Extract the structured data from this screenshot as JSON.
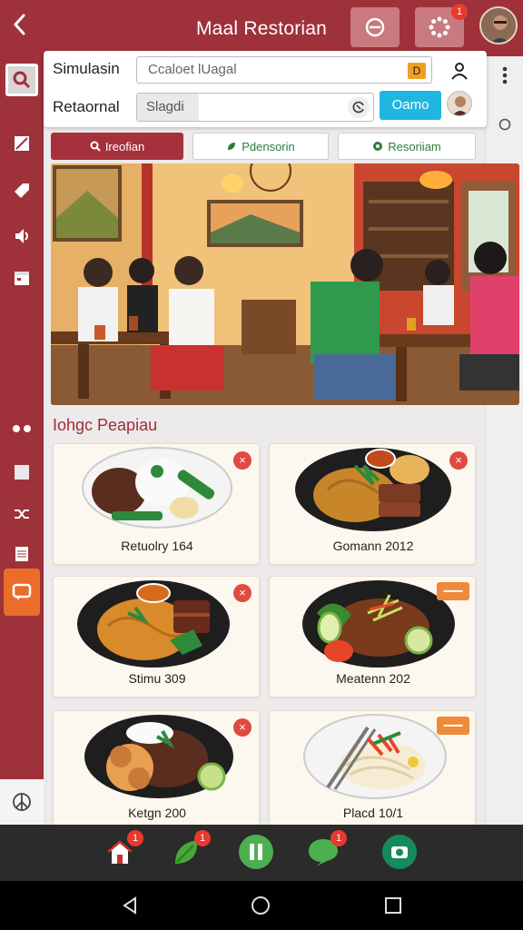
{
  "header": {
    "title": "Maal Restorian",
    "back_icon": "chevron-left-icon",
    "buttons": [
      {
        "icon": "remove-circle-icon"
      },
      {
        "icon": "gear-icon",
        "badge": "1"
      }
    ],
    "avatar_icon": "user-avatar"
  },
  "panel": {
    "row1_label": "Simulasin",
    "row1_value": "Ccaloet lUagal",
    "row1_chip": "D",
    "row2_label": "Retaornal",
    "row2_value": "Slagdi",
    "cta_label": "Oamo"
  },
  "tabs": [
    {
      "label": "Ireofian",
      "icon": "search-icon"
    },
    {
      "label": "Pdensorin",
      "icon": "leaf-icon"
    },
    {
      "label": "Resoriiam",
      "icon": "dot-icon"
    }
  ],
  "section_title": "Iohgc Peapiau",
  "cards": [
    {
      "label": "Retuolry 164",
      "action": "x"
    },
    {
      "label": "Gomann 2012",
      "action": "x"
    },
    {
      "label": "Stimu 309",
      "action": "x"
    },
    {
      "label": "Meatenn 202",
      "action": "tag"
    },
    {
      "label": "Ketgn 200",
      "action": "x"
    },
    {
      "label": "Placd 10/1",
      "action": "tag"
    }
  ],
  "bottom_nav": [
    {
      "icon": "home-icon",
      "badge": "1"
    },
    {
      "icon": "leaf-icon",
      "badge": "1"
    },
    {
      "icon": "pause-icon",
      "badge": ""
    },
    {
      "icon": "chat-icon",
      "badge": "1"
    },
    {
      "icon": "camera-icon",
      "badge": ""
    }
  ],
  "colors": {
    "brand": "#9e3139",
    "accent_orange": "#ea6e2a",
    "cta_blue": "#1fb6e0",
    "badge_red": "#e83a2c",
    "bottom_bar": "#2b2b2b"
  }
}
